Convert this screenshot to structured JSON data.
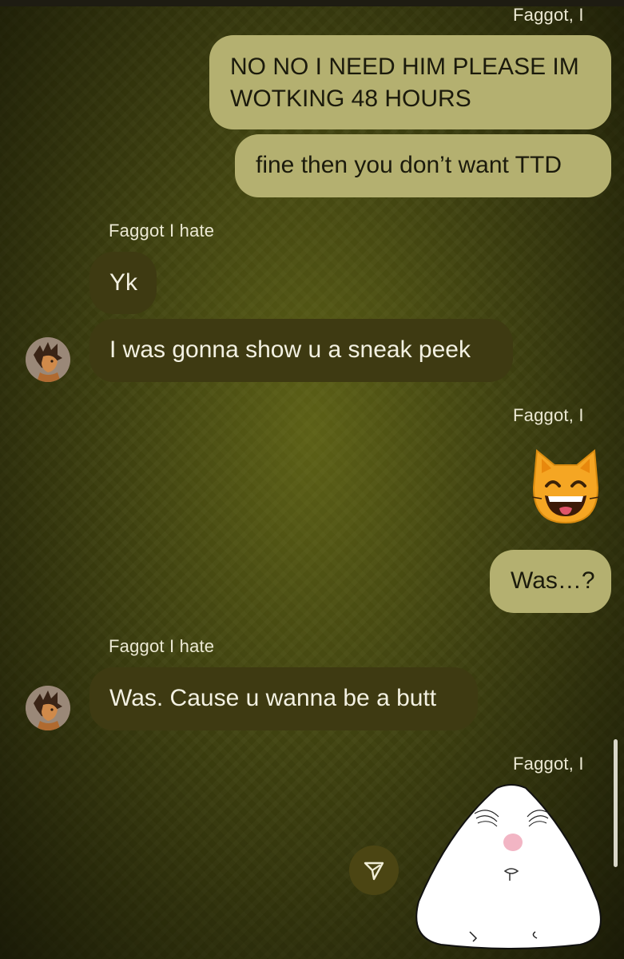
{
  "messages": [
    {
      "label": "Faggot, I"
    },
    {
      "text": "NO NO I NEED HIM PLEASE IM WOTKING 48 HOURS"
    },
    {
      "text": "fine then you don’t want TTD"
    },
    {
      "label": "Faggot I hate"
    },
    {
      "text": "Yk"
    },
    {
      "text": "I was gonna show u a sneak peek"
    },
    {
      "label": "Faggot, I"
    },
    {
      "emoji": "grinning-cat-emoji"
    },
    {
      "text": "Was…?"
    },
    {
      "label": "Faggot I hate"
    },
    {
      "text": "Was. Cause u wanna be a butt"
    },
    {
      "label": "Faggot, I"
    },
    {
      "sticker": "white-blob-sticker"
    }
  ],
  "icons": {
    "send": "send-icon",
    "avatar": "profile-avatar"
  },
  "colors": {
    "outgoing_bubble": "#b4b070",
    "incoming_bubble": "#3e3a12",
    "background": "#3d4010"
  }
}
